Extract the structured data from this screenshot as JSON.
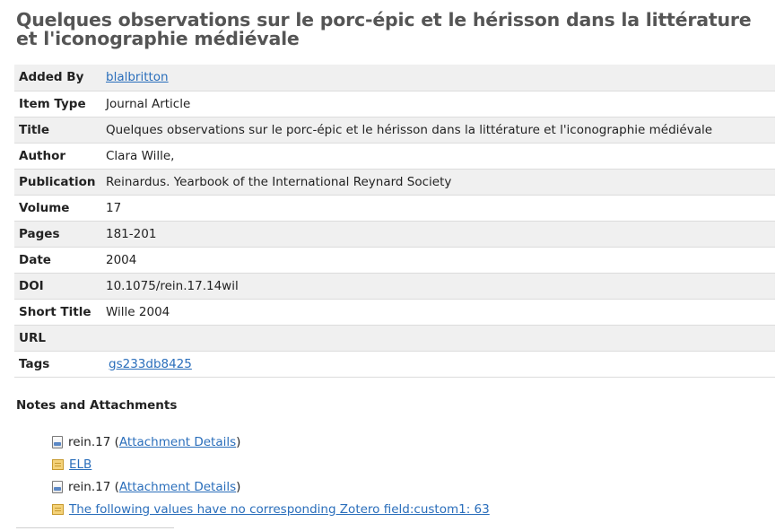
{
  "title": "Quelques observations sur le porc-épic et le hérisson dans la littérature et l'iconographie médiévale",
  "fields": [
    {
      "label": "Added By",
      "value": "blalbritton",
      "link": true
    },
    {
      "label": "Item Type",
      "value": "Journal Article"
    },
    {
      "label": "Title",
      "value": "Quelques observations sur le porc-épic et le hérisson dans la littérature et l'iconographie médiévale"
    },
    {
      "label": "Author",
      "value": "Clara Wille,"
    },
    {
      "label": "Publication",
      "value": "Reinardus. Yearbook of the International Reynard Society"
    },
    {
      "label": "Volume",
      "value": "17"
    },
    {
      "label": "Pages",
      "value": "181-201"
    },
    {
      "label": "Date",
      "value": "2004"
    },
    {
      "label": "DOI",
      "value": "10.1075/rein.17.14wil"
    },
    {
      "label": "Short Title",
      "value": "Wille 2004"
    },
    {
      "label": "URL",
      "value": ""
    },
    {
      "label": "Tags",
      "value": "gs233db8425",
      "link": true
    }
  ],
  "notes": {
    "heading": "Notes and Attachments",
    "items": [
      {
        "icon": "file-icon",
        "text": "rein.17",
        "open": " (",
        "link": "Attachment Details",
        "close": ")"
      },
      {
        "icon": "note-icon",
        "link": "ELB"
      },
      {
        "icon": "file-icon",
        "text": "rein.17",
        "open": " (",
        "link": "Attachment Details",
        "close": ")"
      },
      {
        "icon": "note-icon",
        "link": "The following values have no corresponding Zotero field:custom1: 63"
      }
    ]
  }
}
